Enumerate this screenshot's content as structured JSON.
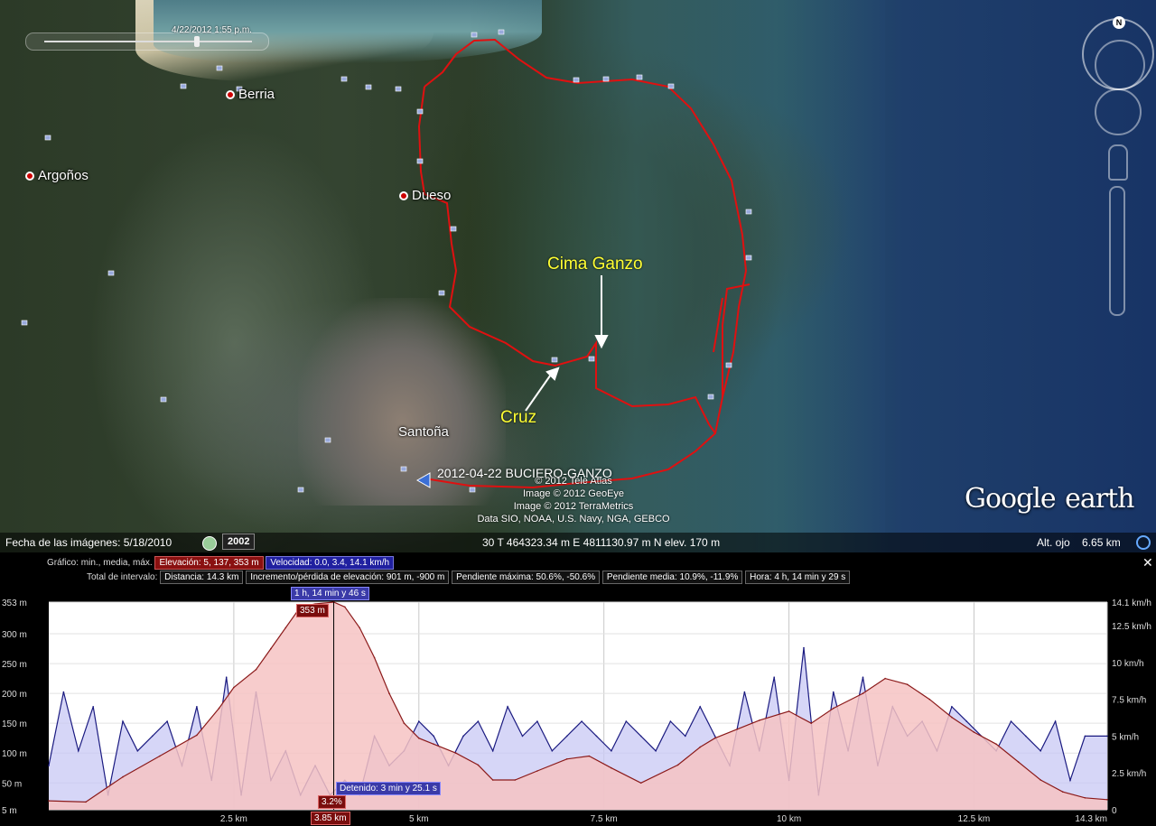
{
  "map": {
    "time_slider_label": "4/22/2012   1:55 p.m.",
    "places": [
      {
        "name": "Berria"
      },
      {
        "name": "Argoños"
      },
      {
        "name": "Dueso"
      },
      {
        "name": "Santoña"
      }
    ],
    "annotations": {
      "cima": "Cima Ganzo",
      "cruz": "Cruz"
    },
    "track_label": "2012-04-22 BUCIERO-GANZO",
    "attribution": [
      "© 2012 Tele Atlas",
      "Image © 2012 GeoEye",
      "Image © 2012 TerraMetrics",
      "Data SIO, NOAA, U.S. Navy, NGA, GEBCO"
    ],
    "logo": {
      "google": "Google",
      "earth": "earth"
    },
    "compass_n": "N"
  },
  "statusbar": {
    "imagery_date": "Fecha de las imágenes: 5/18/2010",
    "year": "2002",
    "coords": "30 T 464323.34 m E 4811130.97 m N elev.   170 m",
    "eye_alt_label": "Alt. ojo",
    "eye_alt_value": "6.65 km"
  },
  "profile": {
    "graph_label": "Gráfico: min., media, máx.",
    "elevation_box": "Elevación: 5, 137, 353 m",
    "speed_box": "Velocidad: 0.0, 3.4, 14.1 km/h",
    "close_glyph": "✕",
    "interval_label": "Total de intervalo:",
    "distance": "Distancia: 14.3 km",
    "gain_loss": "Incremento/pérdida de elevación: 901 m, -900 m",
    "max_slope": "Pendiente máxima: 50.6%, -50.6%",
    "avg_slope": "Pendiente media: 10.9%, -11.9%",
    "time": "Hora: 4 h, 14 min y 29 s",
    "cursor_time": "1 h, 14 min y 46 s",
    "cursor_elev": "353 m",
    "stopped": "Detenido: 3 min y 25.1 s",
    "slope_at_cursor": "3.2%",
    "cursor_dist": "3.85 km"
  },
  "chart_data": {
    "type": "area",
    "x_unit": "km",
    "xlim": [
      0,
      14.3
    ],
    "x_ticks": [
      {
        "v": 2.5,
        "label": "2.5 km"
      },
      {
        "v": 5,
        "label": "5 km"
      },
      {
        "v": 7.5,
        "label": "7.5 km"
      },
      {
        "v": 10,
        "label": "10 km"
      },
      {
        "v": 12.5,
        "label": "12.5 km"
      },
      {
        "v": 14.3,
        "label": "14.3 km"
      }
    ],
    "y_left": {
      "unit": "m",
      "lim": [
        5,
        353
      ],
      "ticks": [
        {
          "v": 5,
          "label": "5 m"
        },
        {
          "v": 50,
          "label": "50 m"
        },
        {
          "v": 100,
          "label": "100 m"
        },
        {
          "v": 150,
          "label": "150 m"
        },
        {
          "v": 200,
          "label": "200 m"
        },
        {
          "v": 250,
          "label": "250 m"
        },
        {
          "v": 300,
          "label": "300 m"
        },
        {
          "v": 353,
          "label": "353 m"
        }
      ]
    },
    "y_right": {
      "unit": "km/h",
      "lim": [
        0,
        14.1
      ],
      "ticks": [
        {
          "v": 0,
          "label": "0"
        },
        {
          "v": 2.5,
          "label": "2.5 km/h"
        },
        {
          "v": 5,
          "label": "5 km/h"
        },
        {
          "v": 7.5,
          "label": "7.5 km/h"
        },
        {
          "v": 10,
          "label": "10 km/h"
        },
        {
          "v": 12.5,
          "label": "12.5 km/h"
        },
        {
          "v": 14.1,
          "label": "14.1 km/h"
        }
      ]
    },
    "cursor_x": 3.85,
    "series": [
      {
        "name": "Elevación",
        "color": "#8b1a1a",
        "fill": "#f6c3c3",
        "x": [
          0,
          0.5,
          1,
          1.5,
          2,
          2.3,
          2.5,
          2.8,
          3.0,
          3.2,
          3.4,
          3.6,
          3.85,
          4.0,
          4.2,
          4.4,
          4.6,
          4.8,
          5.0,
          5.2,
          5.5,
          5.8,
          6.0,
          6.3,
          6.6,
          7.0,
          7.3,
          7.6,
          8.0,
          8.5,
          8.8,
          9.0,
          9.3,
          9.6,
          10.0,
          10.3,
          10.6,
          11.0,
          11.3,
          11.6,
          11.9,
          12.2,
          12.5,
          12.8,
          13.1,
          13.4,
          13.7,
          14.0,
          14.3
        ],
        "values": [
          20,
          18,
          60,
          95,
          130,
          175,
          210,
          240,
          275,
          310,
          345,
          350,
          353,
          345,
          310,
          260,
          200,
          150,
          125,
          115,
          100,
          80,
          55,
          55,
          70,
          90,
          95,
          75,
          50,
          80,
          110,
          125,
          140,
          155,
          170,
          150,
          175,
          200,
          225,
          215,
          190,
          160,
          135,
          115,
          85,
          55,
          35,
          25,
          22
        ]
      },
      {
        "name": "Velocidad",
        "color": "#1a1a80",
        "fill": "#c8c8f4",
        "x": [
          0,
          0.2,
          0.4,
          0.6,
          0.8,
          1.0,
          1.2,
          1.4,
          1.6,
          1.8,
          2.0,
          2.2,
          2.4,
          2.6,
          2.8,
          3.0,
          3.2,
          3.4,
          3.6,
          3.8,
          4.0,
          4.2,
          4.4,
          4.6,
          4.8,
          5.0,
          5.2,
          5.4,
          5.6,
          5.8,
          6.0,
          6.2,
          6.4,
          6.6,
          6.8,
          7.0,
          7.2,
          7.4,
          7.6,
          7.8,
          8.0,
          8.2,
          8.4,
          8.6,
          8.8,
          9.0,
          9.2,
          9.4,
          9.6,
          9.8,
          10.0,
          10.2,
          10.4,
          10.6,
          10.8,
          11.0,
          11.2,
          11.4,
          11.6,
          11.8,
          12.0,
          12.2,
          12.4,
          12.6,
          12.8,
          13.0,
          13.2,
          13.4,
          13.6,
          13.8,
          14.0,
          14.3
        ],
        "values": [
          3,
          8,
          4,
          7,
          1,
          6,
          4,
          5,
          6,
          3,
          7,
          2,
          9,
          1,
          8,
          2,
          4,
          1,
          3,
          1,
          2,
          1,
          5,
          3,
          4,
          6,
          5,
          3,
          5,
          6,
          4,
          7,
          5,
          6,
          4,
          5,
          6,
          5,
          4,
          6,
          5,
          4,
          6,
          5,
          7,
          5,
          3,
          8,
          4,
          9,
          2,
          11,
          1,
          8,
          4,
          9,
          3,
          7,
          5,
          6,
          4,
          7,
          6,
          5,
          4,
          6,
          5,
          4,
          6,
          2,
          5,
          5
        ]
      }
    ]
  }
}
